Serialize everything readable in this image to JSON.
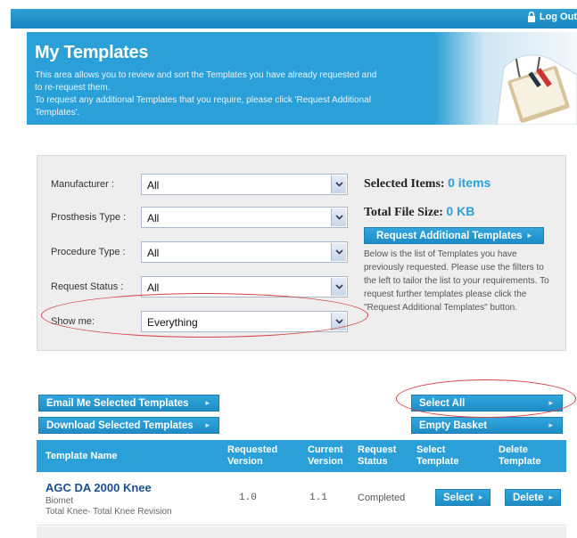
{
  "topbar": {
    "logout_label": "Log Out"
  },
  "header": {
    "title": "My Templates",
    "intro_line1": "This area allows you to review and sort the Templates you have already requested and to re-request them.",
    "intro_line2": "To request any additional Templates that you require, please click 'Request Additional Templates'."
  },
  "filters": {
    "manufacturer": {
      "label": "Manufacturer :",
      "value": "All"
    },
    "prosthesis_type": {
      "label": "Prosthesis Type :",
      "value": "All"
    },
    "procedure_type": {
      "label": "Procedure Type :",
      "value": "All"
    },
    "request_status": {
      "label": "Request Status :",
      "value": "All"
    },
    "show_me": {
      "label": "Show me:",
      "value": "Everything"
    }
  },
  "summary": {
    "selected_items_label": "Selected Items:",
    "selected_items_value": "0 items",
    "total_size_label": "Total File Size:",
    "total_size_value": "0 KB",
    "request_button": "Request Additional Templates",
    "description": "Below is the list of Templates you have previously requested. Please use the filters to the left to tailor the list to your requirements. To request further templates please click the \"Request Additional Templates\" button."
  },
  "actions": {
    "email": "Email Me Selected Templates",
    "download": "Download Selected Templates",
    "select_all": "Select All",
    "empty_basket": "Empty Basket"
  },
  "table": {
    "headers": {
      "name": "Template Name",
      "requested_version": "Requested Version",
      "current_version": "Current Version",
      "request_status": "Request Status",
      "select": "Select Template",
      "delete": "Delete Template"
    },
    "rows": [
      {
        "name": "AGC DA 2000 Knee",
        "manufacturer": "Biomet",
        "category": "Total Knee- Total Knee Revision",
        "requested_version": "1.0",
        "current_version": "1.1",
        "status": "Completed",
        "select_label": "Select",
        "delete_label": "Delete"
      }
    ]
  },
  "colors": {
    "accent": "#2ba0d8",
    "annotation": "#d6434a"
  }
}
